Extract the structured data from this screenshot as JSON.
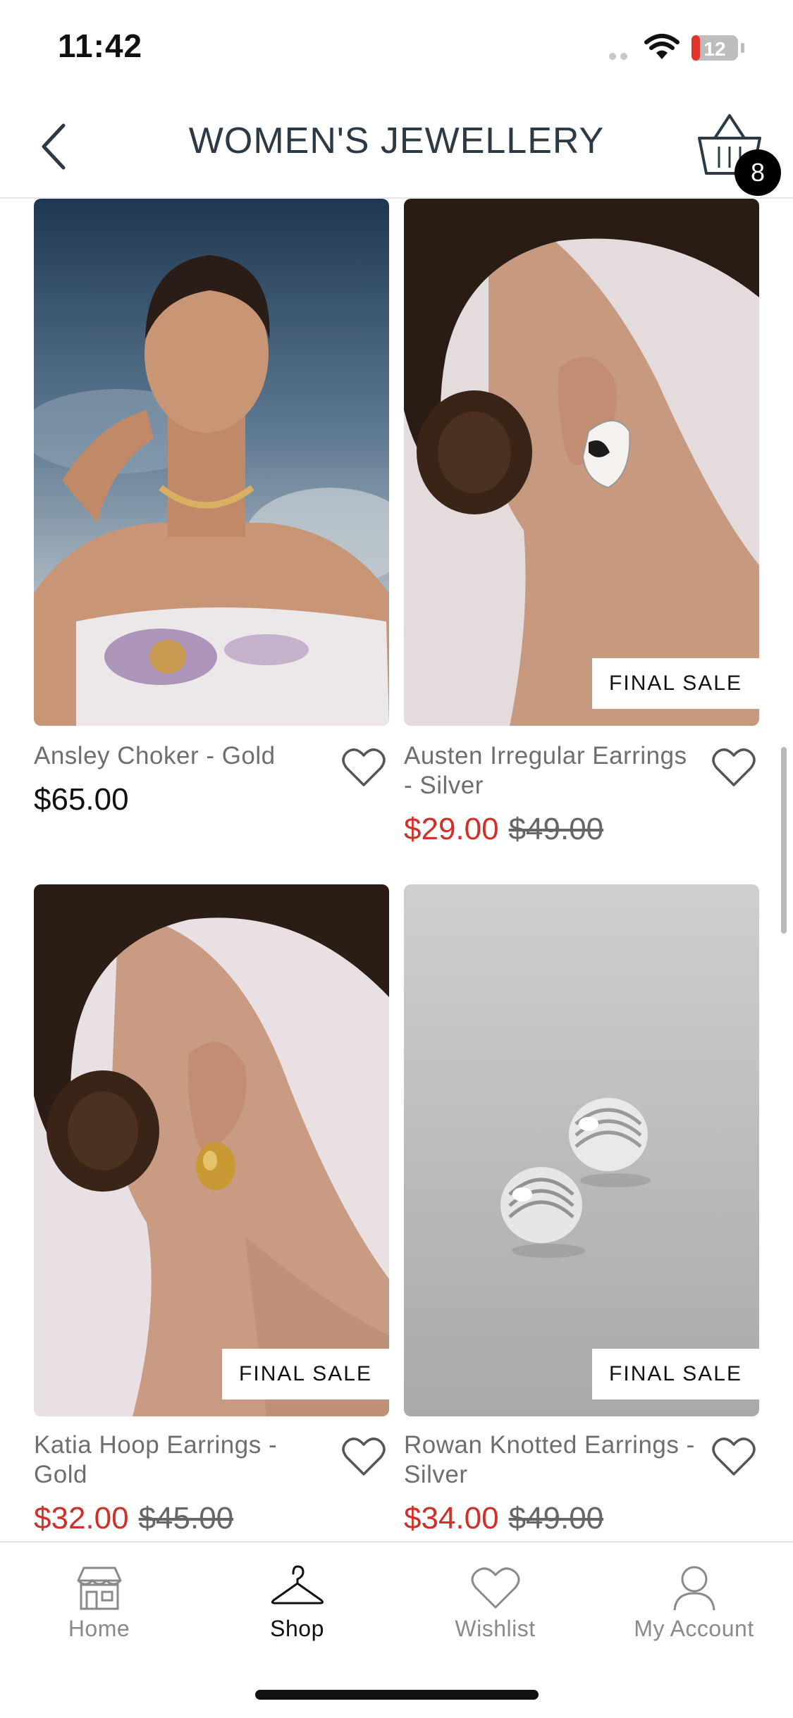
{
  "status_bar": {
    "time": "11:42",
    "battery": "12"
  },
  "header": {
    "title": "WOMEN'S JEWELLERY",
    "basket_count": "8"
  },
  "products": [
    {
      "name": "Ansley Choker - Gold",
      "price": "$65.00",
      "sale_price": "",
      "was_price": "",
      "badge": ""
    },
    {
      "name": "Austen Irregular Earrings - Silver",
      "price": "",
      "sale_price": "$29.00",
      "was_price": "$49.00",
      "badge": "FINAL SALE"
    },
    {
      "name": "Katia Hoop Earrings - Gold",
      "price": "",
      "sale_price": "$32.00",
      "was_price": "$45.00",
      "badge": "FINAL SALE"
    },
    {
      "name": "Rowan Knotted Earrings - Silver",
      "price": "",
      "sale_price": "$34.00",
      "was_price": "$49.00",
      "badge": "FINAL SALE"
    }
  ],
  "tabs": [
    {
      "label": "Home",
      "icon": "storefront-icon",
      "active": false
    },
    {
      "label": "Shop",
      "icon": "hanger-icon",
      "active": true
    },
    {
      "label": "Wishlist",
      "icon": "heart-icon",
      "active": false
    },
    {
      "label": "My Account",
      "icon": "user-icon",
      "active": false
    }
  ],
  "colors": {
    "sale_red": "#d0302a",
    "title_color": "#2b3a44",
    "muted_text": "#6e6e6e"
  }
}
